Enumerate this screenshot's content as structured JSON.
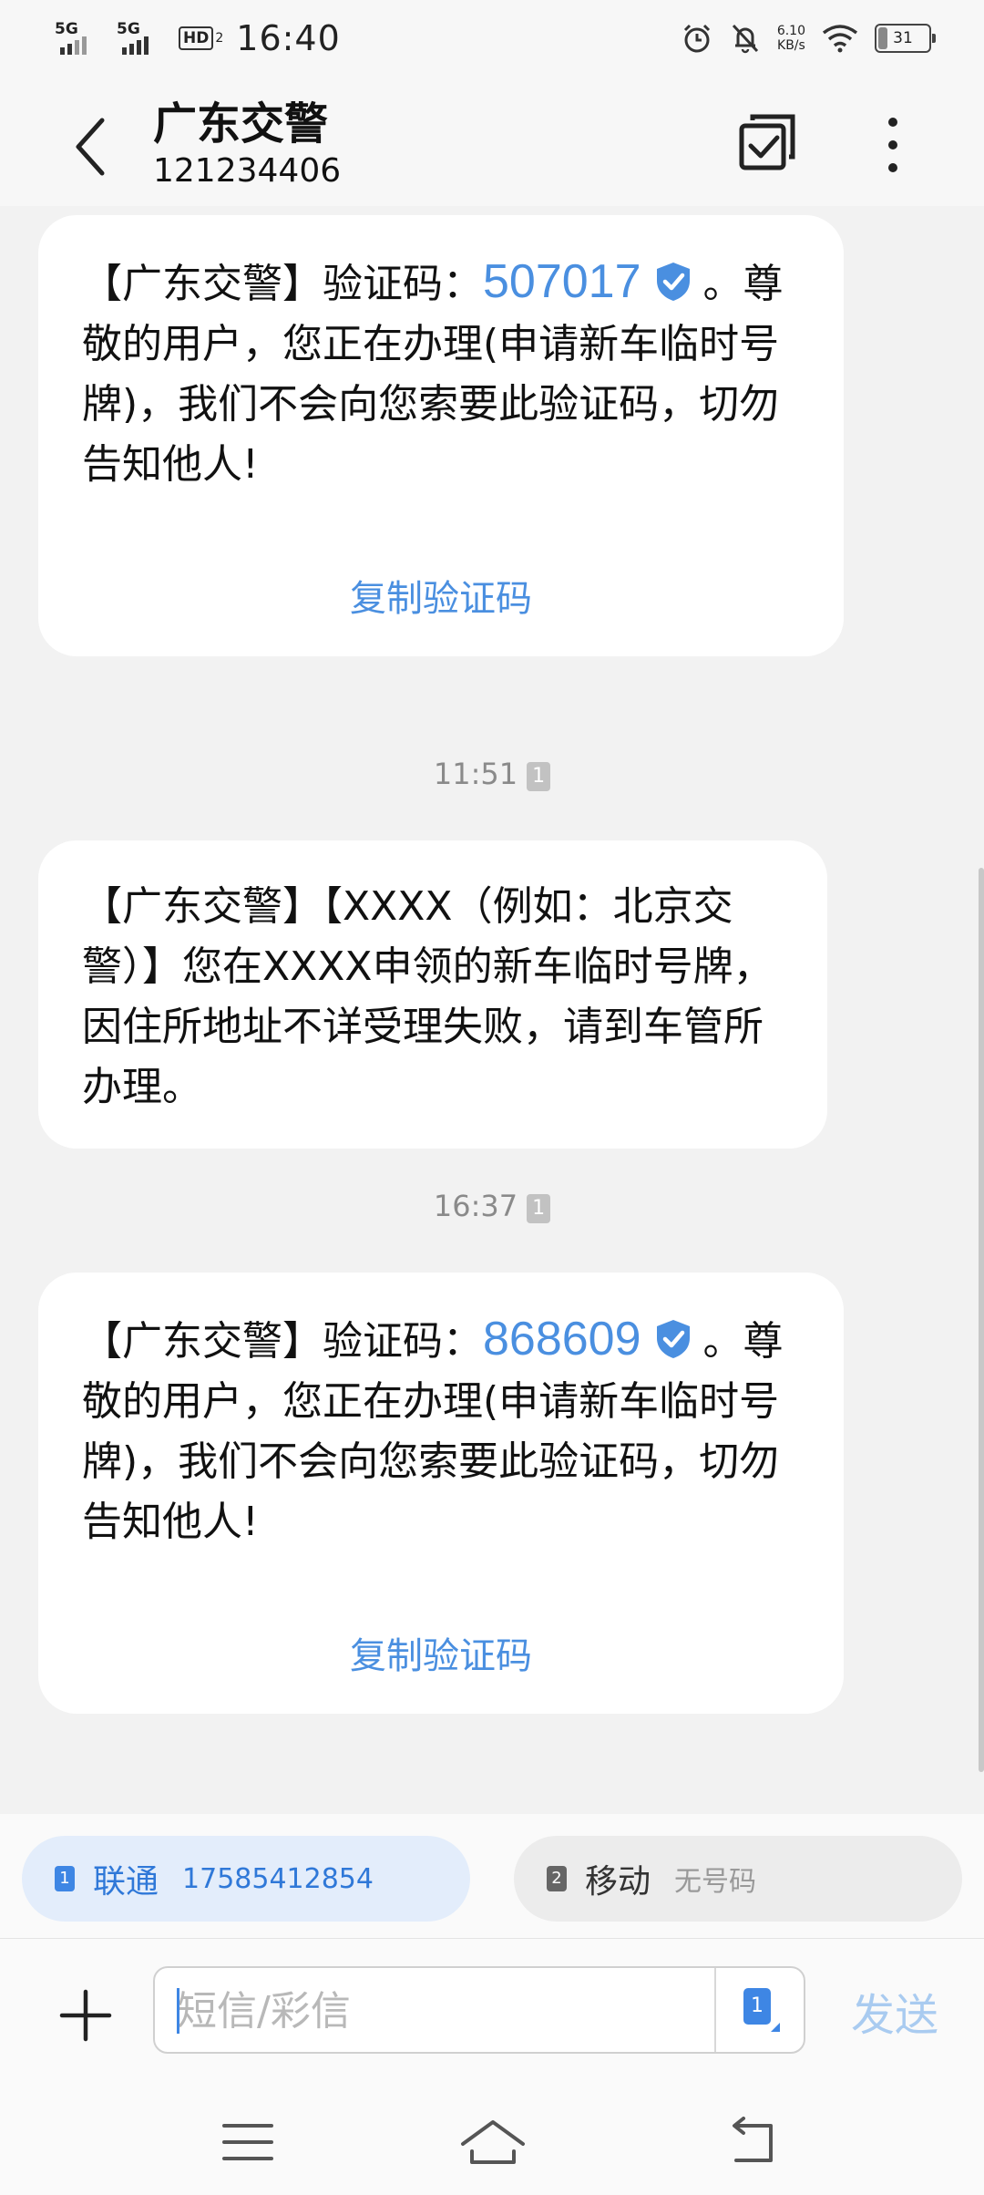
{
  "status_bar": {
    "sim1_network": "5G",
    "sim2_network": "5G",
    "hd_label": "HD",
    "hd_sub": "2",
    "time": "16:40",
    "net_speed_value": "6.10",
    "net_speed_unit": "KB/s",
    "battery": "31",
    "icons": [
      "signal-icon",
      "signal-icon",
      "hd-voice-icon",
      "alarm-icon",
      "mute-bell-icon",
      "wifi-icon",
      "battery-icon"
    ]
  },
  "header": {
    "title": "广东交警",
    "number": "121234406",
    "icons": [
      "back-icon",
      "multi-select-icon",
      "more-icon"
    ]
  },
  "messages": [
    {
      "prefix": "【广东交警】验证码：",
      "code": "507017",
      "suffix": "。尊敬的用户，您正在办理(申请新车临时号牌)，我们不会向您索要此验证码，切勿告知他人!",
      "copy_label": "复制验证码"
    },
    {
      "timestamp": "11:51",
      "sim_badge": "1",
      "text": "【广东交警】【XXXX（例如：北京交警）】您在XXXX申领的新车临时号牌，因住所地址不详受理失败，请到车管所办理。"
    },
    {
      "timestamp": "16:37",
      "sim_badge": "1",
      "prefix": "【广东交警】验证码：",
      "code": "868609",
      "suffix": "。尊敬的用户，您正在办理(申请新车临时号牌)，我们不会向您索要此验证码，切勿告知他人!",
      "copy_label": "复制验证码"
    }
  ],
  "sim_selector": {
    "sim1": {
      "badge": "1",
      "carrier": "联通",
      "number": "17585412854"
    },
    "sim2": {
      "badge": "2",
      "carrier": "移动",
      "number": "无号码"
    }
  },
  "composer": {
    "placeholder": "短信/彩信",
    "sim_badge": "1",
    "send_label": "发送"
  },
  "colors": {
    "accent": "#4a8fe0",
    "background": "#f2f2f2",
    "bubble": "#ffffff",
    "send_disabled": "#a9cbf0"
  }
}
